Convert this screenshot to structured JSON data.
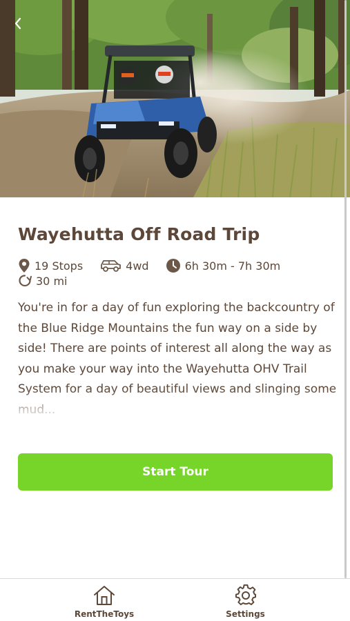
{
  "hero": {
    "image_description_icon": "off-road-utv-photo",
    "back_icon": "chevron-left-icon"
  },
  "tour": {
    "title": "Wayehutta Off Road Trip",
    "stops": "19 Stops",
    "vehicle": "4wd",
    "duration": "6h 30m - 7h 30m",
    "distance": "30 mi",
    "description": "You're in for a day of fun exploring the backcountry of the Blue Ridge Mountains the fun way on a side by side! There are points of interest all along the way as you make your way into the Wayehutta OHV Trail System for a day of beautiful views and slinging some mud..."
  },
  "actions": {
    "start_label": "Start Tour"
  },
  "tabbar": {
    "items": [
      {
        "label": "RentTheToys",
        "icon": "home-icon"
      },
      {
        "label": "Settings",
        "icon": "gear-icon"
      }
    ]
  },
  "colors": {
    "accent": "#77d52a",
    "text": "#5c4738",
    "icon": "#6b5848"
  }
}
